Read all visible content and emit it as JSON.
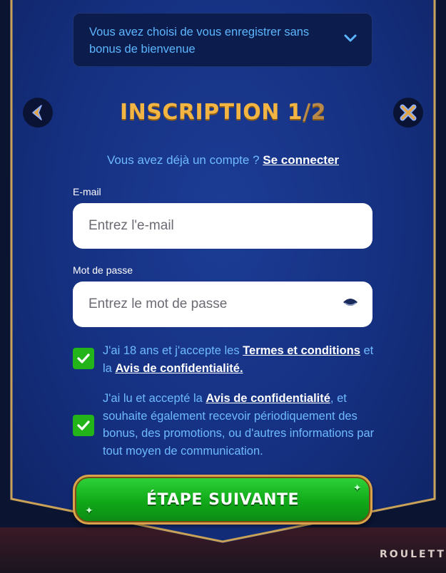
{
  "bonus_select": {
    "text": "Vous avez choisi de vous enregistrer sans bonus de bienvenue"
  },
  "header": {
    "title_main": "INSCRIPTION 1",
    "title_total": "/2"
  },
  "login_prompt": {
    "text": "Vous avez déjà un compte ? ",
    "link": "Se connecter"
  },
  "email": {
    "label": "E-mail",
    "placeholder": "Entrez l'e-mail",
    "value": ""
  },
  "password": {
    "label": "Mot de passe",
    "placeholder": "Entrez le mot de passe",
    "value": ""
  },
  "consent_terms": {
    "checked": true,
    "text_1": "J'ai 18 ans et j'accepte les ",
    "link_1": "Termes et conditions",
    "text_2": " et la ",
    "link_2": "Avis de confidentialité."
  },
  "consent_marketing": {
    "checked": true,
    "text_1": "J'ai lu et accepté la ",
    "link_1": "Avis de confidentialité",
    "text_2": ", et souhaite également recevoir périodiquement des bonus, des promotions, ou d'autres informations par tout moyen de communication."
  },
  "next_button": {
    "label": "ÉTAPE SUIVANTE"
  },
  "background": {
    "game_label": "ROULETT"
  },
  "colors": {
    "accent_gold": "#f2b443",
    "link_blue": "#6fbaff",
    "checkbox_green": "#22b418",
    "panel_blue": "#153080"
  },
  "icons": {
    "back": "chevron-left-icon",
    "close": "close-icon",
    "dropdown": "chevron-down-icon",
    "password_toggle": "eye-icon",
    "check": "checkmark-icon"
  }
}
